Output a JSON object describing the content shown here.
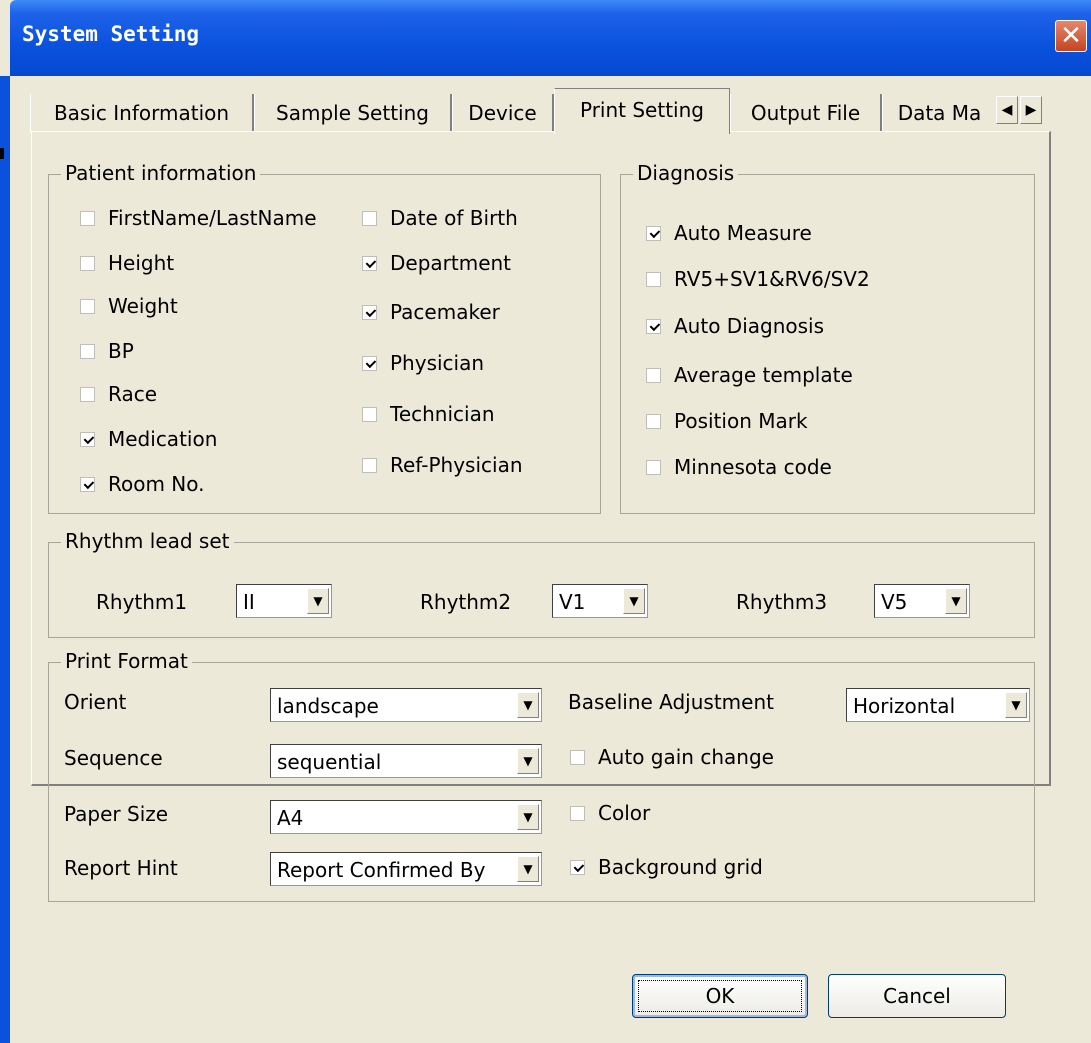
{
  "window": {
    "title": "System Setting",
    "close_glyph": "✕"
  },
  "tabs": [
    {
      "label": "Basic Information",
      "active": false
    },
    {
      "label": "Sample Setting",
      "active": false
    },
    {
      "label": "Device",
      "active": false
    },
    {
      "label": "Print Setting",
      "active": true
    },
    {
      "label": "Output File",
      "active": false
    },
    {
      "label": "Data Ma",
      "active": false
    }
  ],
  "tab_scroll": {
    "left_icon": "arrow-left-icon",
    "right_icon": "arrow-right-icon",
    "left_glyph": "◀",
    "right_glyph": "▶"
  },
  "patient_info": {
    "title": "Patient information",
    "col1": [
      {
        "label": "FirstName/LastName",
        "checked": false
      },
      {
        "label": "Height",
        "checked": false
      },
      {
        "label": "Weight",
        "checked": false
      },
      {
        "label": "BP",
        "checked": false
      },
      {
        "label": "Race",
        "checked": false
      },
      {
        "label": "Medication",
        "checked": true
      },
      {
        "label": "Room No.",
        "checked": true
      }
    ],
    "col2": [
      {
        "label": "Date of Birth",
        "checked": false
      },
      {
        "label": "Department",
        "checked": true
      },
      {
        "label": "Pacemaker",
        "checked": true
      },
      {
        "label": "Physician",
        "checked": true
      },
      {
        "label": "Technician",
        "checked": false
      },
      {
        "label": "Ref-Physician",
        "checked": false
      }
    ]
  },
  "diagnosis": {
    "title": "Diagnosis",
    "items": [
      {
        "label": "Auto Measure",
        "checked": true
      },
      {
        "label": "RV5+SV1&RV6/SV2",
        "checked": false
      },
      {
        "label": "Auto Diagnosis",
        "checked": true
      },
      {
        "label": "Average template",
        "checked": false
      },
      {
        "label": "Position Mark",
        "checked": false
      },
      {
        "label": "Minnesota code",
        "checked": false
      }
    ]
  },
  "rhythm": {
    "title": "Rhythm lead set",
    "items": [
      {
        "label": "Rhythm1",
        "value": "II"
      },
      {
        "label": "Rhythm2",
        "value": "V1"
      },
      {
        "label": "Rhythm3",
        "value": "V5"
      }
    ]
  },
  "print_format": {
    "title": "Print Format",
    "fields": [
      {
        "label": "Orient",
        "value": "landscape"
      },
      {
        "label": "Sequence",
        "value": "sequential"
      },
      {
        "label": "Paper Size",
        "value": "A4"
      },
      {
        "label": "Report Hint",
        "value": "Report Confirmed By"
      }
    ],
    "baseline": {
      "label": "Baseline Adjustment",
      "value": "Horizontal"
    },
    "options": [
      {
        "label": "Auto gain change",
        "checked": false
      },
      {
        "label": "Color",
        "checked": false
      },
      {
        "label": "Background grid",
        "checked": true
      }
    ]
  },
  "dropdown_glyph": "▼",
  "buttons": {
    "ok": "OK",
    "cancel": "Cancel"
  }
}
